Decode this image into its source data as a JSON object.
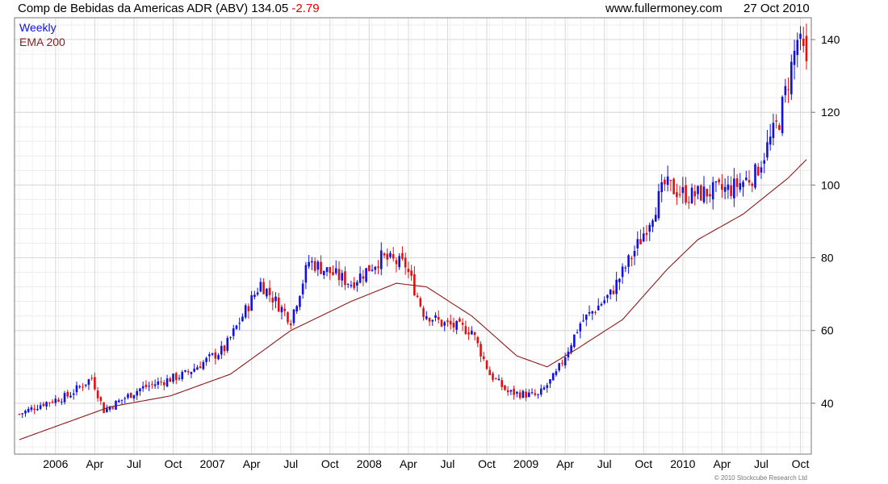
{
  "header": {
    "name": "Comp de Bebidas da Americas ADR (ABV)",
    "price": "134.05",
    "change": "-2.79",
    "site": "www.fullermoney.com",
    "date": "27 Oct 2010"
  },
  "legend": {
    "weekly": "Weekly",
    "ema": "EMA 200"
  },
  "credit": "© 2010 Stockcube Research Ltd",
  "colors": {
    "up": "#1010e0",
    "down": "#e01010",
    "ema": "#8b1a1a",
    "grid": "#d8d8d8",
    "change": "#e00000"
  },
  "chart_data": {
    "type": "candlestick",
    "title": "Comp de Bebidas da Americas ADR (ABV) 134.05 -2.79",
    "frequency": "Weekly",
    "y_ticks": [
      40,
      60,
      80,
      100,
      120,
      140
    ],
    "ylim": [
      26,
      146
    ],
    "x_tick_labels": [
      "2006",
      "Apr",
      "Jul",
      "Oct",
      "2007",
      "Apr",
      "Jul",
      "Oct",
      "2008",
      "Apr",
      "Jul",
      "Oct",
      "2009",
      "Apr",
      "Jul",
      "Oct",
      "2010",
      "Apr",
      "Jul",
      "Oct"
    ],
    "start_period": "2005-10",
    "weeks": 262,
    "x_tick_weeks": [
      12,
      25,
      38,
      51,
      64,
      77,
      90,
      103,
      116,
      129,
      142,
      155,
      168,
      181,
      194,
      207,
      220,
      233,
      246,
      259
    ],
    "close_anchors": [
      [
        0,
        37
      ],
      [
        8,
        40
      ],
      [
        16,
        42
      ],
      [
        24,
        47
      ],
      [
        28,
        38
      ],
      [
        40,
        44
      ],
      [
        55,
        48
      ],
      [
        68,
        55
      ],
      [
        80,
        73
      ],
      [
        90,
        63
      ],
      [
        96,
        79
      ],
      [
        110,
        73
      ],
      [
        120,
        80
      ],
      [
        128,
        78
      ],
      [
        134,
        65
      ],
      [
        140,
        62
      ],
      [
        150,
        60
      ],
      [
        156,
        48
      ],
      [
        162,
        43
      ],
      [
        172,
        42
      ],
      [
        178,
        48
      ],
      [
        186,
        62
      ],
      [
        196,
        70
      ],
      [
        206,
        85
      ],
      [
        214,
        100
      ],
      [
        222,
        97
      ],
      [
        228,
        98
      ],
      [
        236,
        99
      ],
      [
        244,
        103
      ],
      [
        252,
        118
      ],
      [
        258,
        140
      ],
      [
        261,
        134
      ]
    ],
    "ema200_anchors": [
      [
        0,
        30
      ],
      [
        30,
        39
      ],
      [
        50,
        42
      ],
      [
        70,
        48
      ],
      [
        90,
        60
      ],
      [
        110,
        68
      ],
      [
        125,
        73
      ],
      [
        135,
        72
      ],
      [
        150,
        64
      ],
      [
        165,
        53
      ],
      [
        175,
        50
      ],
      [
        185,
        55
      ],
      [
        200,
        63
      ],
      [
        215,
        77
      ],
      [
        225,
        85
      ],
      [
        240,
        92
      ],
      [
        255,
        102
      ],
      [
        261,
        107
      ]
    ],
    "last_close": 134.05,
    "change": -2.79,
    "series": [
      {
        "name": "Weekly"
      },
      {
        "name": "EMA 200"
      }
    ]
  }
}
